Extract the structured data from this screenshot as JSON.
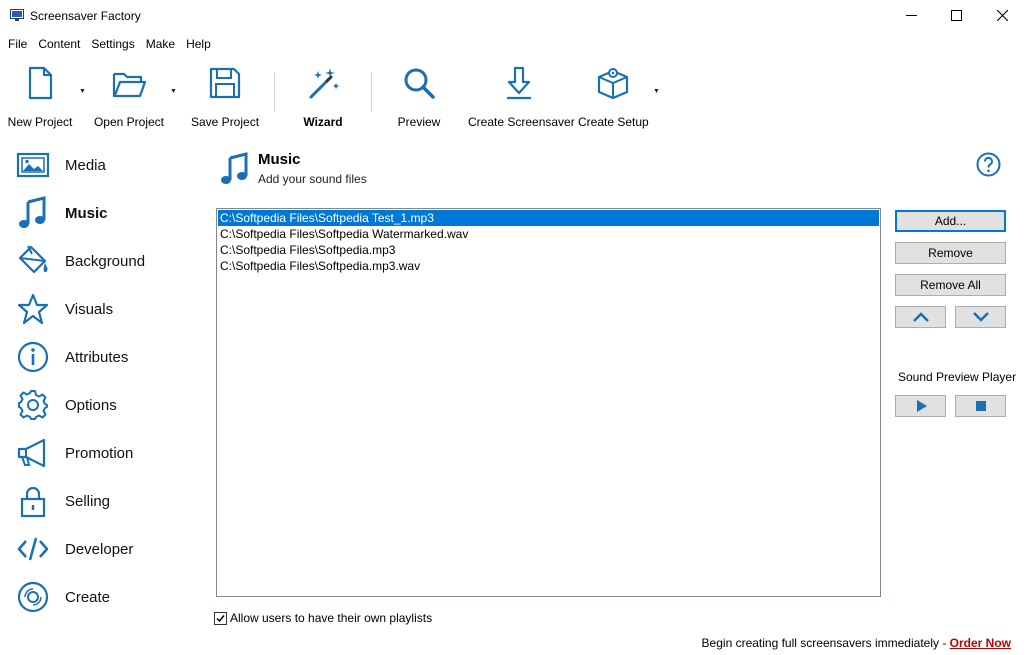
{
  "window": {
    "title": "Screensaver Factory",
    "controls": [
      "minimize",
      "maximize",
      "close"
    ]
  },
  "menu": [
    "File",
    "Content",
    "Settings",
    "Make",
    "Help"
  ],
  "toolbar": {
    "new_project": "New Project",
    "open_project": "Open Project",
    "save_project": "Save Project",
    "wizard": "Wizard",
    "preview": "Preview",
    "create_screensaver": "Create Screensaver",
    "create_setup": "Create Setup"
  },
  "sidebar": {
    "items": [
      {
        "label": "Media",
        "icon": "image-icon"
      },
      {
        "label": "Music",
        "icon": "music-note-icon",
        "active": true
      },
      {
        "label": "Background",
        "icon": "paint-bucket-icon"
      },
      {
        "label": "Visuals",
        "icon": "star-icon"
      },
      {
        "label": "Attributes",
        "icon": "info-icon"
      },
      {
        "label": "Options",
        "icon": "gear-icon"
      },
      {
        "label": "Promotion",
        "icon": "megaphone-icon"
      },
      {
        "label": "Selling",
        "icon": "lock-icon"
      },
      {
        "label": "Developer",
        "icon": "code-icon"
      },
      {
        "label": "Create",
        "icon": "disc-icon"
      }
    ]
  },
  "page": {
    "title": "Music",
    "subtitle": "Add your sound files"
  },
  "files": [
    "C:\\Softpedia Files\\Softpedia Test_1.mp3",
    "C:\\Softpedia Files\\Softpedia Watermarked.wav",
    "C:\\Softpedia Files\\Softpedia.mp3",
    "C:\\Softpedia Files\\Softpedia.mp3.wav"
  ],
  "selected_file_index": 0,
  "buttons": {
    "add": "Add...",
    "remove": "Remove",
    "remove_all": "Remove All"
  },
  "player": {
    "label": "Sound Preview Player"
  },
  "allow_playlists": {
    "label": "Allow users to have their own playlists",
    "checked": true
  },
  "footer": {
    "text": "Begin creating full screensavers immediately - ",
    "link": "Order Now"
  },
  "colors": {
    "accent": "#0078d7",
    "icon": "#1a6fb5",
    "link": "#c00000"
  }
}
